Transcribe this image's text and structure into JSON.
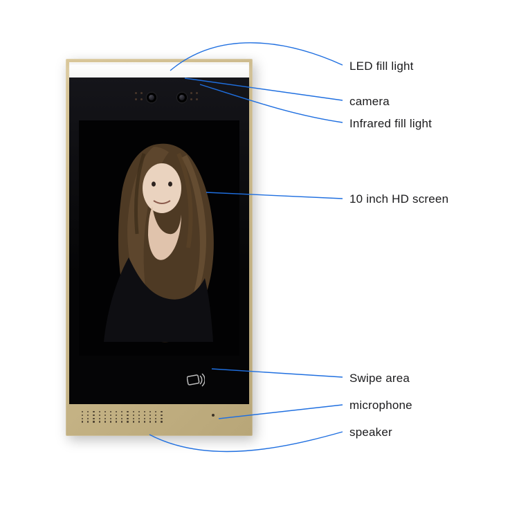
{
  "labels": {
    "led_fill_light": "LED fill light",
    "camera": "camera",
    "infrared_fill_light": "Infrared fill light",
    "screen": "10 inch HD screen",
    "swipe_area": "Swipe area",
    "microphone": "microphone",
    "speaker": "speaker"
  },
  "colors": {
    "callout_line": "#1f6fe0",
    "bezel_gold": "#c9b88d",
    "panel_black": "#0a0a0b"
  }
}
